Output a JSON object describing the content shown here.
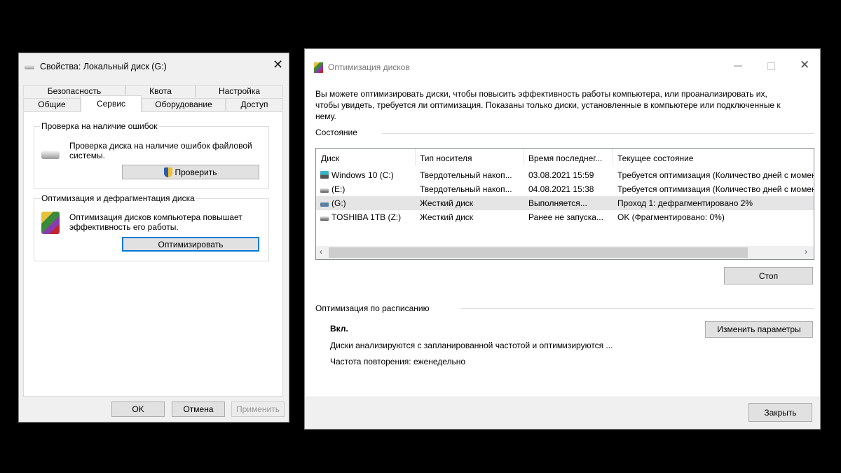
{
  "props": {
    "title": "Свойства: Локальный диск (G:)",
    "tabs_row1": [
      "Безопасность",
      "Квота",
      "Настройка"
    ],
    "tabs_row2": [
      "Общие",
      "Сервис",
      "Оборудование",
      "Доступ"
    ],
    "check_group": {
      "label": "Проверка на наличие ошибок",
      "desc": "Проверка диска на наличие ошибок файловой системы.",
      "button": "Проверить"
    },
    "optimize_group": {
      "label": "Оптимизация и дефрагментация диска",
      "desc": "Оптимизация дисков компьютера повышает эффективность его работы.",
      "button": "Оптимизировать"
    },
    "ok": "OK",
    "cancel": "Отмена",
    "apply": "Применить"
  },
  "optimize": {
    "title": "Оптимизация дисков",
    "intro": "Вы можете оптимизировать диски, чтобы повысить эффективность работы  компьютера, или проанализировать их, чтобы увидеть, требуется ли оптимизация. Показаны только диски, установленные в компьютере или подключенные к нему.",
    "status_label": "Состояние",
    "columns": [
      "Диск",
      "Тип носителя",
      "Время последнег...",
      "Текущее состояние"
    ],
    "rows": [
      {
        "disk": "Windows 10 (C:)",
        "type": "Твердотельный накоп...",
        "time": "03.08.2021 15:59",
        "state": "Требуется оптимизация (Количество дней с момента"
      },
      {
        "disk": "(E:)",
        "type": "Твердотельный накоп...",
        "time": "04.08.2021 15:38",
        "state": "Требуется оптимизация (Количество дней с момента"
      },
      {
        "disk": "(G:)",
        "type": "Жесткий диск",
        "time": "Выполняется...",
        "state": "Проход 1: дефрагментировано 2%"
      },
      {
        "disk": "TOSHIBA 1TB (Z:)",
        "type": "Жесткий диск",
        "time": "Ранее не запуска...",
        "state": "OK (Фрагментировано: 0%)"
      }
    ],
    "stop": "Стоп",
    "schedule_label": "Оптимизация по расписанию",
    "schedule_on": "Вкл.",
    "schedule_desc": "Диски анализируются с запланированной частотой и оптимизируются ...",
    "schedule_freq": "Частота повторения: еженедельно",
    "change": "Изменить параметры",
    "close": "Закрыть"
  }
}
